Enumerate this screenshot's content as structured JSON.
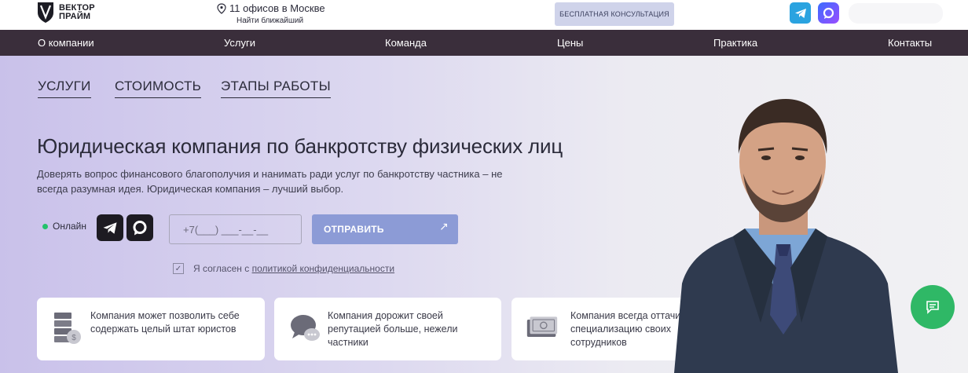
{
  "header": {
    "logo_line1": "ВЕКТОР",
    "logo_line2": "ПРАЙМ",
    "offices_text": "11 офисов в Москве",
    "offices_sub": "Найти ближайший",
    "consult_label": "БЕСПЛАТНАЯ КОНСУЛЬТАЦИЯ",
    "icons": [
      "telegram-icon",
      "max-messenger-icon"
    ]
  },
  "nav": {
    "items": [
      "О компании",
      "Услуги",
      "Команда",
      "Цены",
      "Практика",
      "Контакты"
    ]
  },
  "subnav": {
    "items": [
      "УСЛУГИ",
      "СТОИМОСТЬ",
      "ЭТАПЫ РАБОТЫ"
    ]
  },
  "hero": {
    "title": "Юридическая компания по банкротству физических лиц",
    "lead": "Доверять вопрос финансового благополучия и нанимать ради услуг по банкротству частника – не всегда разумная идея. Юридическая компания – лучший выбор.",
    "online_label": "Онлайн",
    "phone_placeholder": "+7(___) ___-__-__",
    "send_label": "ОТПРАВИТЬ",
    "agree_prefix": "Я согласен с ",
    "agree_link": "политикой конфиденциальности"
  },
  "cards": [
    {
      "icon": "document-stack-icon",
      "text": "Компания может позволить себе содержать целый штат юристов"
    },
    {
      "icon": "chat-bubbles-icon",
      "text": "Компания дорожит своей репутацией больше, нежели частники"
    },
    {
      "icon": "money-icon",
      "text": "Компания всегда оттачивает специализацию своих сотрудников"
    }
  ],
  "colors": {
    "nav_bg": "#3a2e3b",
    "accent_button": "#8c9bd6",
    "online_dot": "#23c26b",
    "chat_fab": "#2fb866"
  }
}
